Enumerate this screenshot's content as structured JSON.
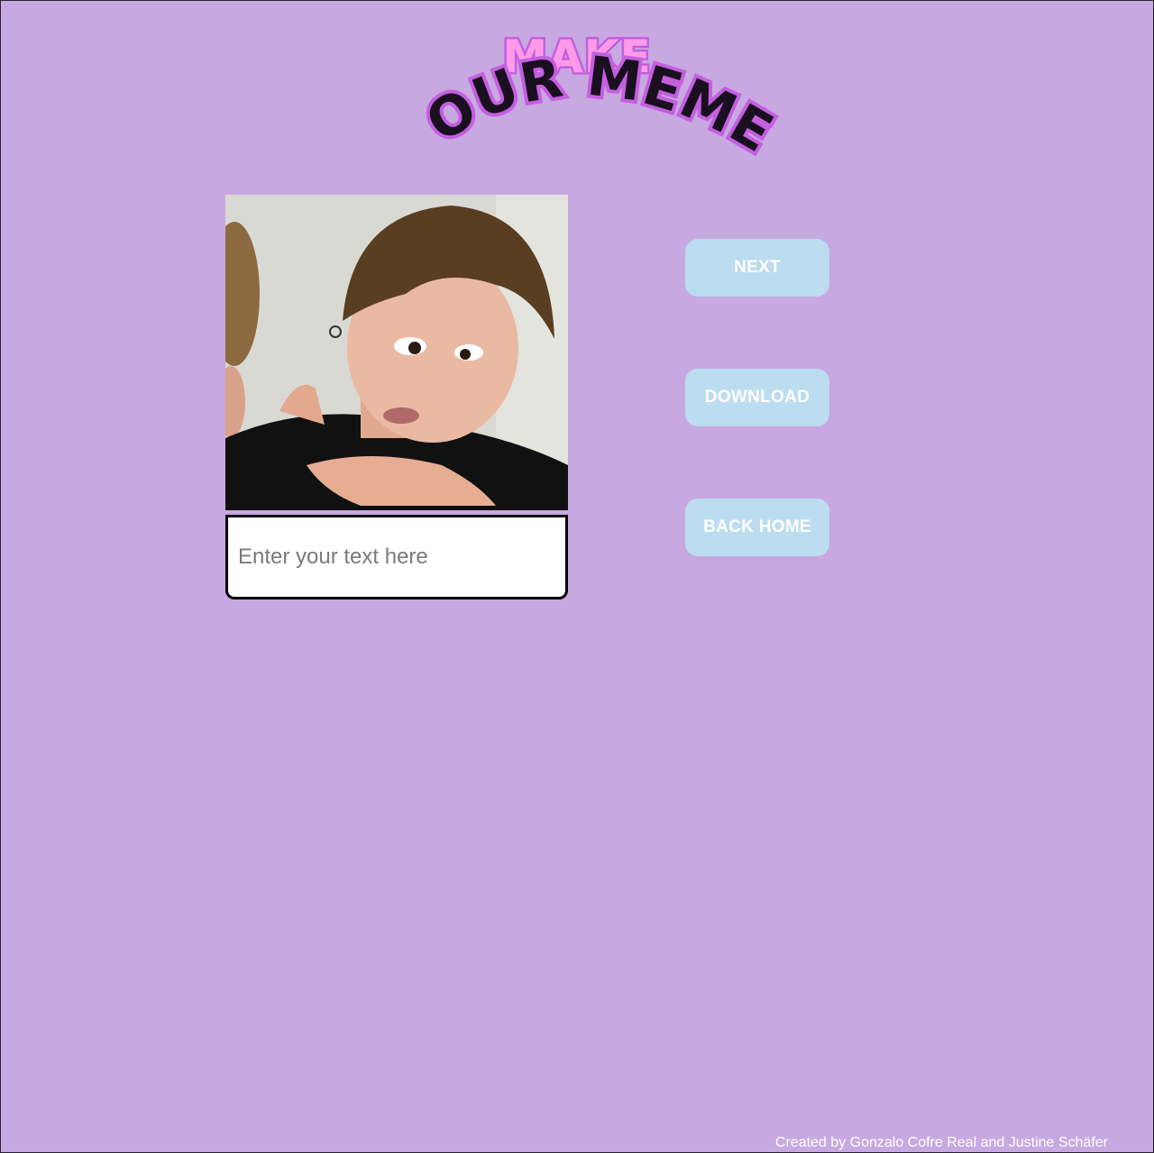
{
  "header": {
    "logo_line1": "MAKE",
    "logo_line2": "YOUR MEME!"
  },
  "editor": {
    "image_alt": "meme image",
    "text_placeholder": "Enter your text here",
    "text_value": ""
  },
  "actions": {
    "next_label": "NEXT",
    "download_label": "DOWNLOAD",
    "back_home_label": "BACK HOME"
  },
  "footer": {
    "credit": "Created by Gonzalo Cofre Real and Justine Schäfer"
  },
  "colors": {
    "background": "#c8a8e0",
    "button": "#bcdcef",
    "button_text": "#ffffff",
    "logo_pink": "#ff9ae8",
    "logo_outline": "#c45fe0"
  }
}
